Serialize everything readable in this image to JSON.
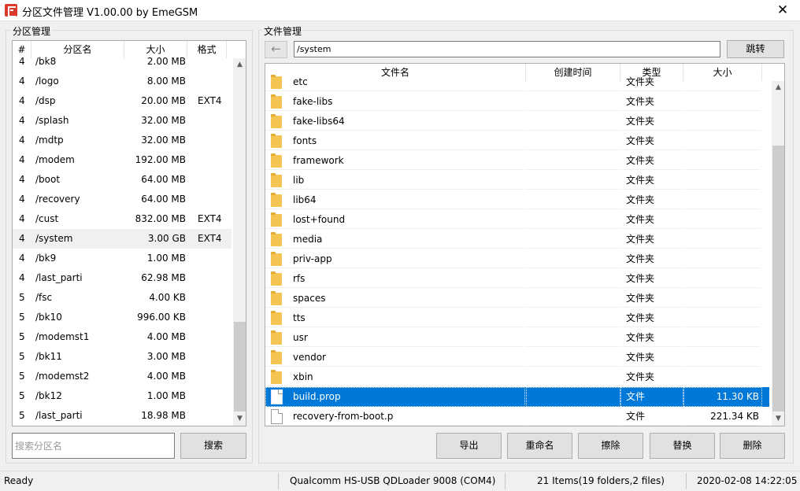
{
  "window": {
    "title": "分区文件管理 V1.00.00 by EmeGSM",
    "close": "✕"
  },
  "partitions": {
    "group_title": "分区管理",
    "columns": {
      "num": "#",
      "name": "分区名",
      "size": "大小",
      "format": "格式"
    },
    "rows": [
      {
        "num": "4",
        "name": "/bk8",
        "size": "2.00 MB",
        "format": ""
      },
      {
        "num": "4",
        "name": "/logo",
        "size": "8.00 MB",
        "format": ""
      },
      {
        "num": "4",
        "name": "/dsp",
        "size": "20.00 MB",
        "format": "EXT4"
      },
      {
        "num": "4",
        "name": "/splash",
        "size": "32.00 MB",
        "format": ""
      },
      {
        "num": "4",
        "name": "/mdtp",
        "size": "32.00 MB",
        "format": ""
      },
      {
        "num": "4",
        "name": "/modem",
        "size": "192.00 MB",
        "format": ""
      },
      {
        "num": "4",
        "name": "/boot",
        "size": "64.00 MB",
        "format": ""
      },
      {
        "num": "4",
        "name": "/recovery",
        "size": "64.00 MB",
        "format": ""
      },
      {
        "num": "4",
        "name": "/cust",
        "size": "832.00 MB",
        "format": "EXT4"
      },
      {
        "num": "4",
        "name": "/system",
        "size": "3.00 GB",
        "format": "EXT4",
        "selected": true
      },
      {
        "num": "4",
        "name": "/bk9",
        "size": "1.00 MB",
        "format": ""
      },
      {
        "num": "4",
        "name": "/last_parti",
        "size": "62.98 MB",
        "format": ""
      },
      {
        "num": "5",
        "name": "/fsc",
        "size": "4.00 KB",
        "format": ""
      },
      {
        "num": "5",
        "name": "/bk10",
        "size": "996.00 KB",
        "format": ""
      },
      {
        "num": "5",
        "name": "/modemst1",
        "size": "4.00 MB",
        "format": ""
      },
      {
        "num": "5",
        "name": "/bk11",
        "size": "3.00 MB",
        "format": ""
      },
      {
        "num": "5",
        "name": "/modemst2",
        "size": "4.00 MB",
        "format": ""
      },
      {
        "num": "5",
        "name": "/bk12",
        "size": "1.00 MB",
        "format": ""
      },
      {
        "num": "5",
        "name": "/last_parti",
        "size": "18.98 MB",
        "format": ""
      }
    ],
    "search_placeholder": "搜索分区名",
    "search_button": "搜索"
  },
  "files": {
    "group_title": "文件管理",
    "back_arrow": "←",
    "path": "/system",
    "goto_button": "跳转",
    "columns": {
      "name": "文件名",
      "created": "创建时间",
      "type": "类型",
      "size": "大小"
    },
    "rows": [
      {
        "name": "etc",
        "created": "",
        "type": "文件夹",
        "size": "",
        "kind": "folder"
      },
      {
        "name": "fake-libs",
        "created": "",
        "type": "文件夹",
        "size": "",
        "kind": "folder"
      },
      {
        "name": "fake-libs64",
        "created": "",
        "type": "文件夹",
        "size": "",
        "kind": "folder"
      },
      {
        "name": "fonts",
        "created": "",
        "type": "文件夹",
        "size": "",
        "kind": "folder"
      },
      {
        "name": "framework",
        "created": "",
        "type": "文件夹",
        "size": "",
        "kind": "folder"
      },
      {
        "name": "lib",
        "created": "",
        "type": "文件夹",
        "size": "",
        "kind": "folder"
      },
      {
        "name": "lib64",
        "created": "",
        "type": "文件夹",
        "size": "",
        "kind": "folder"
      },
      {
        "name": "lost+found",
        "created": "",
        "type": "文件夹",
        "size": "",
        "kind": "folder"
      },
      {
        "name": "media",
        "created": "",
        "type": "文件夹",
        "size": "",
        "kind": "folder"
      },
      {
        "name": "priv-app",
        "created": "",
        "type": "文件夹",
        "size": "",
        "kind": "folder"
      },
      {
        "name": "rfs",
        "created": "",
        "type": "文件夹",
        "size": "",
        "kind": "folder"
      },
      {
        "name": "spaces",
        "created": "",
        "type": "文件夹",
        "size": "",
        "kind": "folder"
      },
      {
        "name": "tts",
        "created": "",
        "type": "文件夹",
        "size": "",
        "kind": "folder"
      },
      {
        "name": "usr",
        "created": "",
        "type": "文件夹",
        "size": "",
        "kind": "folder"
      },
      {
        "name": "vendor",
        "created": "",
        "type": "文件夹",
        "size": "",
        "kind": "folder"
      },
      {
        "name": "xbin",
        "created": "",
        "type": "文件夹",
        "size": "",
        "kind": "folder"
      },
      {
        "name": "build.prop",
        "created": "",
        "type": "文件",
        "size": "11.30 KB",
        "kind": "file",
        "selected": true
      },
      {
        "name": "recovery-from-boot.p",
        "created": "",
        "type": "文件",
        "size": "221.34 KB",
        "kind": "file"
      }
    ],
    "buttons": {
      "export": "导出",
      "rename": "重命名",
      "erase": "擦除",
      "replace": "替换",
      "delete": "删除"
    }
  },
  "status": {
    "state": "Ready",
    "device": "Qualcomm HS-USB QDLoader 9008 (COM4)",
    "items": "21 Items(19 folders,2 files)",
    "datetime": "2020-02-08 14:22:05"
  },
  "colors": {
    "selection": "#0078d7",
    "folder": "#f5c554",
    "brand": "#d93a2b"
  },
  "icons": {
    "app": "app-logo-icon",
    "folder": "folder-icon",
    "file": "file-icon",
    "back": "back-arrow-icon"
  }
}
